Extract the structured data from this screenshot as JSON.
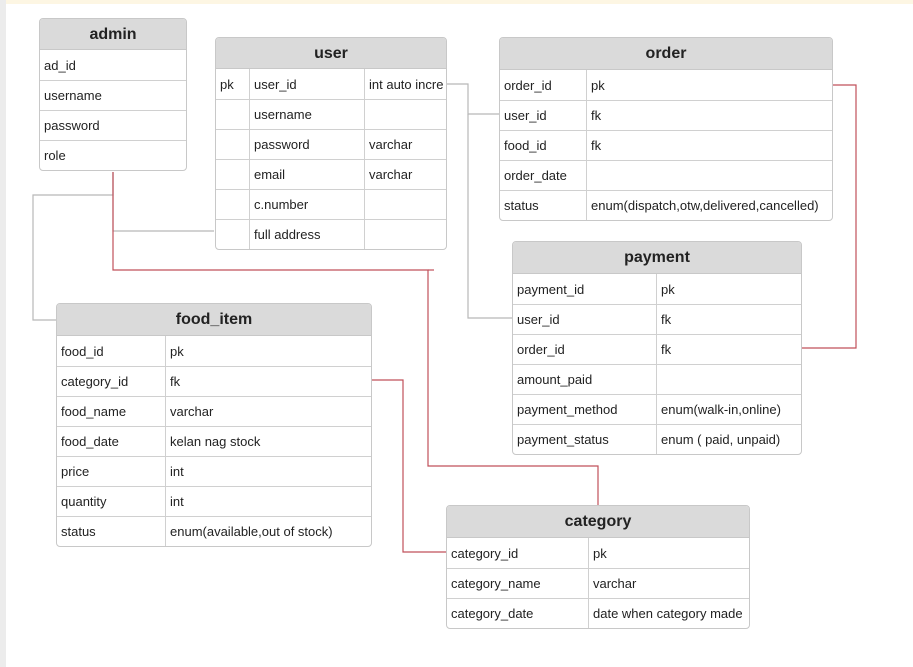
{
  "colors": {
    "header_bg": "#dadada",
    "border": "#c8c8c8",
    "fk_line": "#c0505a",
    "gray_line": "#b8b8b8"
  },
  "tables": {
    "admin": {
      "title": "admin",
      "rows": [
        [
          "ad_id"
        ],
        [
          "username"
        ],
        [
          "password"
        ],
        [
          "role"
        ]
      ]
    },
    "user": {
      "title": "user",
      "rows": [
        [
          "pk",
          "user_id",
          "int auto incre"
        ],
        [
          "",
          "username",
          ""
        ],
        [
          "",
          "password",
          "varchar"
        ],
        [
          "",
          "email",
          "varchar"
        ],
        [
          "",
          "c.number",
          ""
        ],
        [
          "",
          "full address",
          ""
        ]
      ]
    },
    "order": {
      "title": "order",
      "rows": [
        [
          "order_id",
          "pk"
        ],
        [
          "user_id",
          "fk"
        ],
        [
          "food_id",
          "fk"
        ],
        [
          "order_date",
          ""
        ],
        [
          "status",
          "enum(dispatch,otw,delivered,cancelled)"
        ]
      ]
    },
    "payment": {
      "title": "payment",
      "rows": [
        [
          "payment_id",
          "pk"
        ],
        [
          "user_id",
          "fk"
        ],
        [
          "order_id",
          "fk"
        ],
        [
          "amount_paid",
          ""
        ],
        [
          "payment_method",
          "enum(walk-in,online)"
        ],
        [
          "payment_status",
          "enum ( paid, unpaid)"
        ]
      ]
    },
    "food_item": {
      "title": "food_item",
      "rows": [
        [
          "food_id",
          "pk"
        ],
        [
          "category_id",
          "fk"
        ],
        [
          "food_name",
          "varchar"
        ],
        [
          "food_date",
          "kelan nag stock"
        ],
        [
          "price",
          "int"
        ],
        [
          "quantity",
          "int"
        ],
        [
          "status",
          "enum(available,out of stock)"
        ]
      ]
    },
    "category": {
      "title": "category",
      "rows": [
        [
          "category_id",
          "pk"
        ],
        [
          "category_name",
          "varchar"
        ],
        [
          "category_date",
          "date when category made"
        ]
      ]
    }
  }
}
